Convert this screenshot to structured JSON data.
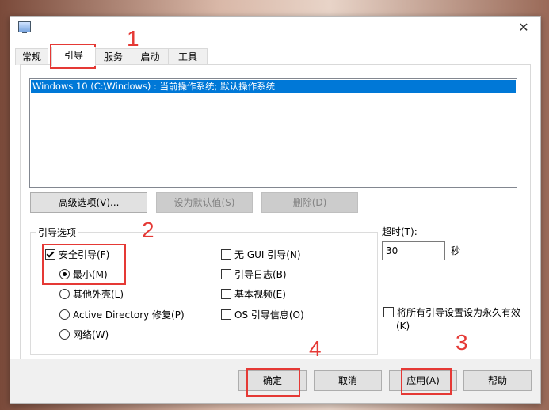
{
  "window": {
    "close_glyph": "✕",
    "app_icon": "msconfig-icon"
  },
  "tabs": [
    {
      "label": "常规"
    },
    {
      "label": "引导"
    },
    {
      "label": "服务"
    },
    {
      "label": "启动"
    },
    {
      "label": "工具"
    }
  ],
  "os_list": {
    "items": [
      "Windows 10 (C:\\Windows) : 当前操作系统; 默认操作系统"
    ]
  },
  "buttons": {
    "advanced": "高级选项(V)...",
    "set_default": "设为默认值(S)",
    "delete": "删除(D)"
  },
  "boot_options": {
    "legend": "引导选项",
    "safe_boot": {
      "label": "安全引导(F)",
      "checked": true
    },
    "minimal": {
      "label": "最小(M)",
      "selected": true
    },
    "alt_shell": {
      "label": "其他外壳(L)",
      "selected": false
    },
    "ad_repair": {
      "label": "Active Directory 修复(P)",
      "selected": false
    },
    "network": {
      "label": "网络(W)",
      "selected": false
    },
    "no_gui": {
      "label": "无 GUI 引导(N)",
      "checked": false
    },
    "boot_log": {
      "label": "引导日志(B)",
      "checked": false
    },
    "base_video": {
      "label": "基本视频(E)",
      "checked": false
    },
    "os_info": {
      "label": "OS 引导信息(O)",
      "checked": false
    }
  },
  "timeout": {
    "label": "超时(T):",
    "value": "30",
    "unit": "秒"
  },
  "permanent": {
    "label_line1": "将所有引导设置设为永久有效",
    "label_line2": "(K)",
    "checked": false
  },
  "footer": {
    "ok": "确定",
    "cancel": "取消",
    "apply": "应用(A)",
    "help": "帮助"
  },
  "annotations": {
    "n1": "1",
    "n2": "2",
    "n3": "3",
    "n4": "4",
    "color": "#e53935"
  },
  "colors": {
    "selection": "#0078d7"
  }
}
